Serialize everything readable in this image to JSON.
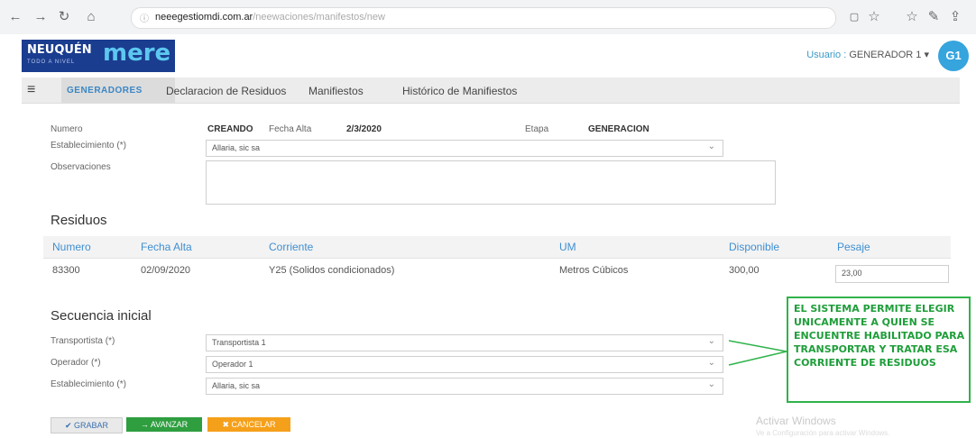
{
  "browser": {
    "url_domain": "neeegestiomdi.com.ar",
    "url_path": "/neewaciones/manifestos/new"
  },
  "header": {
    "logo_left": "NEUQUÉN",
    "logo_left_sub": "TODO A NIVEL",
    "logo_right": "mere",
    "user_prefix": "Usuario :",
    "user_name": "GENERADOR 1",
    "user_caret": "▾",
    "avatar": "G1"
  },
  "menu": {
    "items": [
      {
        "label": "GENERADORES"
      },
      {
        "label": "Declaracion de Residuos"
      },
      {
        "label": "Manifiestos"
      },
      {
        "label": "Histórico de Manifiestos"
      }
    ]
  },
  "form": {
    "numero_label": "Numero",
    "numero_value": "CREANDO",
    "fecha_label": "Fecha Alta",
    "fecha_value": "2/3/2020",
    "etapa_label": "Etapa",
    "etapa_value": "GENERACION",
    "establecimiento_label": "Establecimiento (*)",
    "establecimiento_value": "Allaria, sic sa",
    "observaciones_label": "Observaciones",
    "observaciones_value": ""
  },
  "residuos": {
    "title": "Residuos",
    "columns": [
      "Numero",
      "Fecha Alta",
      "Corriente",
      "UM",
      "Disponible",
      "Pesaje"
    ],
    "rows": [
      {
        "numero": "83300",
        "fecha": "02/09/2020",
        "corriente": "Y25 (Solidos condicionados)",
        "um": "Metros Cúbicos",
        "disponible": "300,00",
        "pesaje": "23,00"
      }
    ]
  },
  "secuencia": {
    "title": "Secuencia inicial",
    "transportista_label": "Transportista (*)",
    "transportista_value": "Transportista 1",
    "operador_label": "Operador (*)",
    "operador_value": "Operador 1",
    "establecimiento_label": "Establecimiento (*)",
    "establecimiento_value": "Allaria, sic sa"
  },
  "buttons": {
    "guardar": "✔ GRABAR",
    "avanzar": "→ AVANZAR",
    "cancelar": "✖ CANCELAR"
  },
  "annotation": {
    "text": "EL SISTEMA PERMITE ELEGIR UNICAMENTE A QUIEN SE ENCUENTRE HABILITADO PARA TRANSPORTAR Y TRATAR ESA CORRIENTE DE RESIDUOS"
  },
  "watermark": {
    "line1": "Activar Windows",
    "line2": "Ve a Configuración para activar Windows."
  },
  "colors": {
    "accent": "#3f8fd2",
    "annotation": "#2fb34a",
    "grabar": "#5a8a3a",
    "avanzar": "#2e9e3f",
    "cancelar": "#f5a01a"
  }
}
